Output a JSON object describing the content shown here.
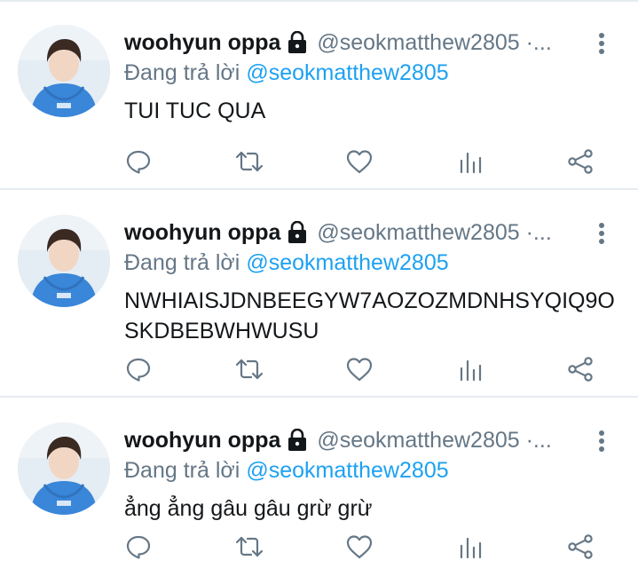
{
  "colors": {
    "text": "#14171a",
    "secondary": "#657786",
    "link": "#1da1f2",
    "divider": "#e6ecf0",
    "hoodie": "#3a86d8"
  },
  "tweets": [
    {
      "display_name": "woohyun oppa",
      "handle": "@seokmatthew2805 ·...",
      "reply_prefix": "Đang trả lời",
      "reply_to": "@seokmatthew2805",
      "text": "TUI TUC QUA"
    },
    {
      "display_name": "woohyun oppa",
      "handle": "@seokmatthew2805 ·...",
      "reply_prefix": "Đang trả lời",
      "reply_to": "@seokmatthew2805",
      "text": "NWHIAISJDNBEEGYW7AOZOZMDNHSYQIQ9OSKDBEBWHWUSU"
    },
    {
      "display_name": "woohyun oppa",
      "handle": "@seokmatthew2805 ·...",
      "reply_prefix": "Đang trả lời",
      "reply_to": "@seokmatthew2805",
      "text": "ẳng ẳng gâu gâu grừ grừ"
    }
  ],
  "icons": {
    "lock": "lock-icon",
    "more": "more-vertical-icon",
    "reply": "reply-icon",
    "retweet": "retweet-icon",
    "like": "heart-icon",
    "stats": "analytics-icon",
    "share": "share-icon"
  }
}
